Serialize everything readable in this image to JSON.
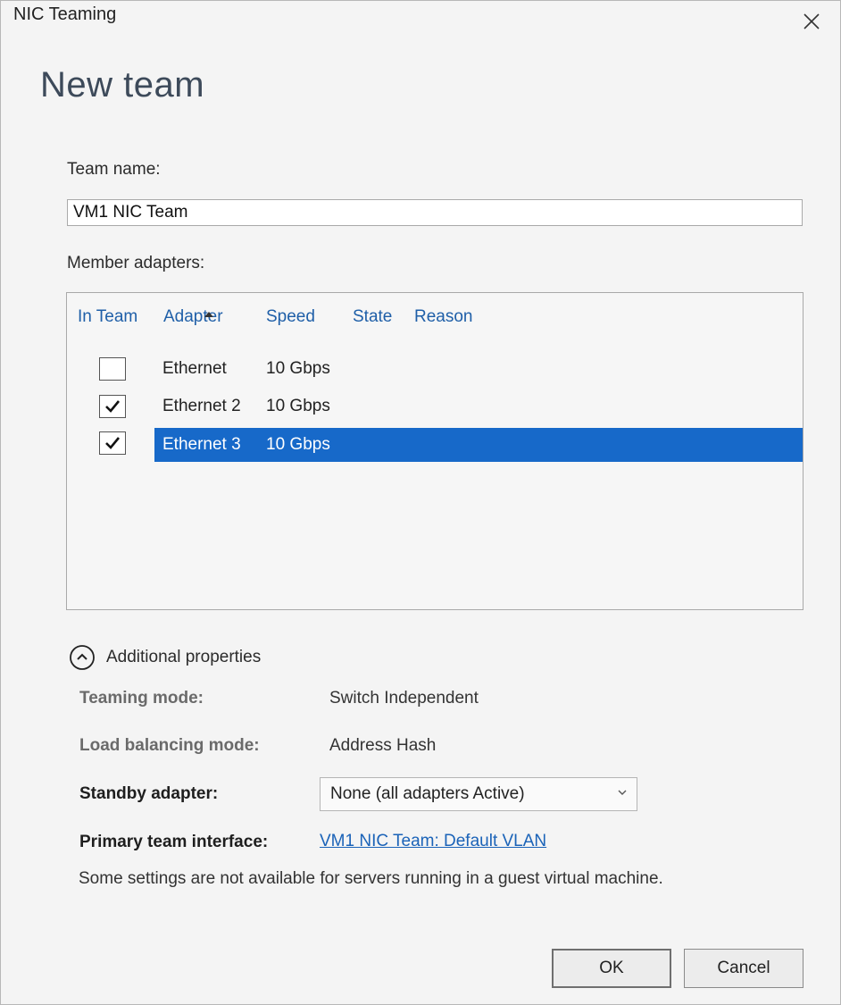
{
  "window": {
    "title": "NIC Teaming"
  },
  "heading": "New team",
  "team_name": {
    "label": "Team name:",
    "value": "VM1 NIC Team"
  },
  "members": {
    "label": "Member adapters:",
    "columns": [
      "In Team",
      "Adapter",
      "Speed",
      "State",
      "Reason"
    ],
    "sorted_column": "Adapter",
    "rows": [
      {
        "in_team": false,
        "adapter": "Ethernet",
        "speed": "10 Gbps",
        "state": "",
        "reason": "",
        "selected": false
      },
      {
        "in_team": true,
        "adapter": "Ethernet 2",
        "speed": "10 Gbps",
        "state": "",
        "reason": "",
        "selected": false
      },
      {
        "in_team": true,
        "adapter": "Ethernet 3",
        "speed": "10 Gbps",
        "state": "",
        "reason": "",
        "selected": true
      }
    ]
  },
  "additional": {
    "toggle_label": "Additional properties",
    "expanded": true,
    "teaming_mode": {
      "label": "Teaming mode:",
      "value": "Switch Independent"
    },
    "load_balancing_mode": {
      "label": "Load balancing mode:",
      "value": "Address Hash"
    },
    "standby_adapter": {
      "label": "Standby adapter:",
      "value": "None (all adapters Active)"
    },
    "primary_interface": {
      "label": "Primary team interface:",
      "value": "VM1 NIC Team: Default VLAN"
    },
    "note": "Some settings are not available for servers running in a guest virtual machine."
  },
  "buttons": {
    "ok": "OK",
    "cancel": "Cancel"
  },
  "colors": {
    "selection": "#1769c9",
    "link": "#1b63b8",
    "column_header": "#1f5fa8"
  }
}
